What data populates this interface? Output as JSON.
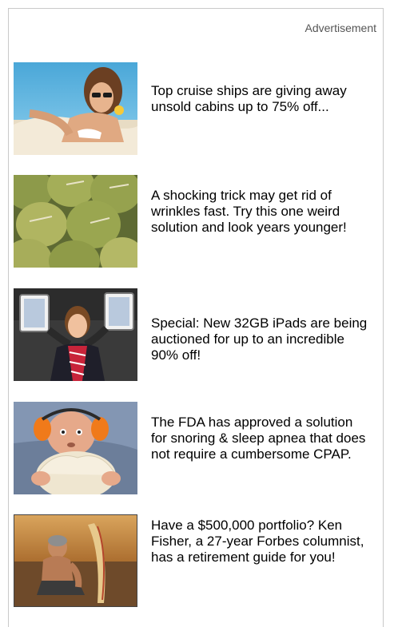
{
  "header": {
    "label": "Advertisement"
  },
  "ads": [
    {
      "image_icon": "cruise-woman-image",
      "text": "Top cruise ships are giving away unsold cabins up to 75% off..."
    },
    {
      "image_icon": "durian-fruit-image",
      "text": "A shocking trick may get rid of wrinkles fast. Try this one weird solution and look years younger!"
    },
    {
      "image_icon": "ipad-man-image",
      "text": "Special: New 32GB iPads are being auctioned for up to an incredible 90% off!"
    },
    {
      "image_icon": "snoring-man-image",
      "text": "The FDA has approved a solution for snoring & sleep apnea that does not require a cumbersome CPAP."
    },
    {
      "image_icon": "beach-man-image",
      "text": "Have a $500,000 portfolio? Ken Fisher, a 27-year Forbes columnist, has a retirement guide for you!"
    }
  ],
  "colors": {
    "border": "#c9c9c9",
    "label": "#555555",
    "text": "#000000"
  }
}
